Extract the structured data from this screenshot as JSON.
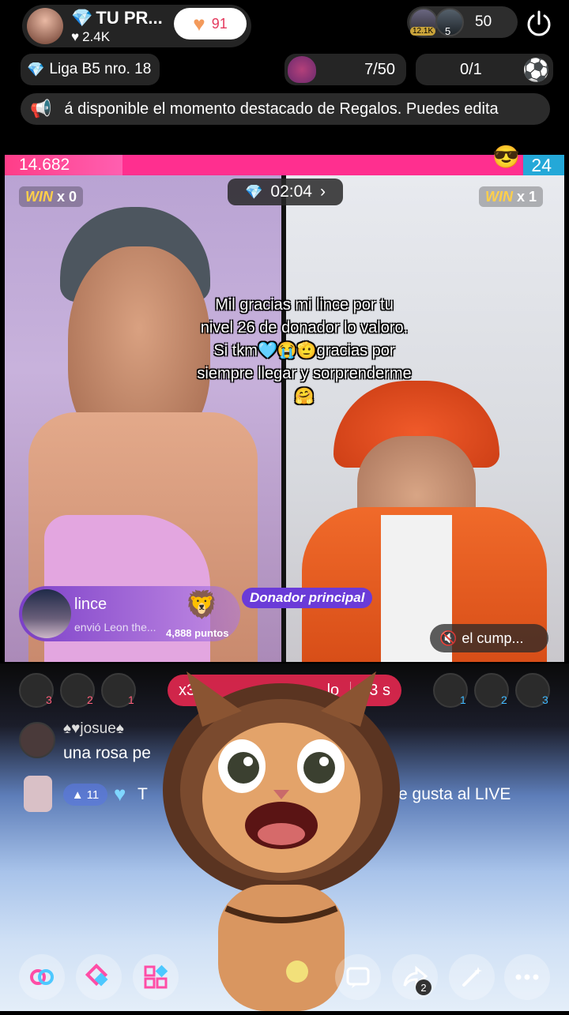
{
  "header": {
    "host_name": "TU PR...",
    "host_likes": "2.4K",
    "follow_count": "91",
    "viewer_badge_1": "12.1K",
    "viewer_badge_2": "5",
    "viewer_count": "50"
  },
  "league": {
    "label": "Liga B5 nro. 18",
    "rank_progress": "7/50",
    "match_progress": "0/1"
  },
  "banner": {
    "text": "á disponible el momento destacado de Regalos. Puedes edita"
  },
  "battle": {
    "left_score": "14.682",
    "right_score": "24",
    "left_fill_fraction": 0.21,
    "left_win_label": "WIN",
    "left_win_count": "x 0",
    "right_win_label": "WIN",
    "right_win_count": "x 1",
    "timer": "02:04",
    "caption_line1": "Mil gracias mi lince  por tu",
    "caption_line2": "nivel 26 de donador  lo valoro.",
    "caption_line3": "Si tkm🩵😭🫡gracias por",
    "caption_line4": "siempre llegar y sorprenderme",
    "caption_line5": "🤗",
    "gift_user": "lince",
    "gift_detail": "envió Leon the...",
    "gift_points": "4,888 puntos",
    "top_donor_label": "Donador principal",
    "muted_label": "el cump..."
  },
  "lower": {
    "left_ranks": [
      "3",
      "2",
      "1"
    ],
    "right_ranks": [
      "1",
      "2",
      "3"
    ],
    "combo_prefix": "x3 p",
    "combo_mid": "lo",
    "combo_timer": "33 s",
    "chat_user": "♠♥josue♠",
    "chat_text": "una rosa pe",
    "chat2_level": "11",
    "chat2_name": "T",
    "chat2_text": "e gusta al LIVE",
    "share_count": "2"
  },
  "colors": {
    "red_side": "#ff2f8f",
    "blue_side": "#24a8d8",
    "accent_purple": "#6a3bd8"
  }
}
